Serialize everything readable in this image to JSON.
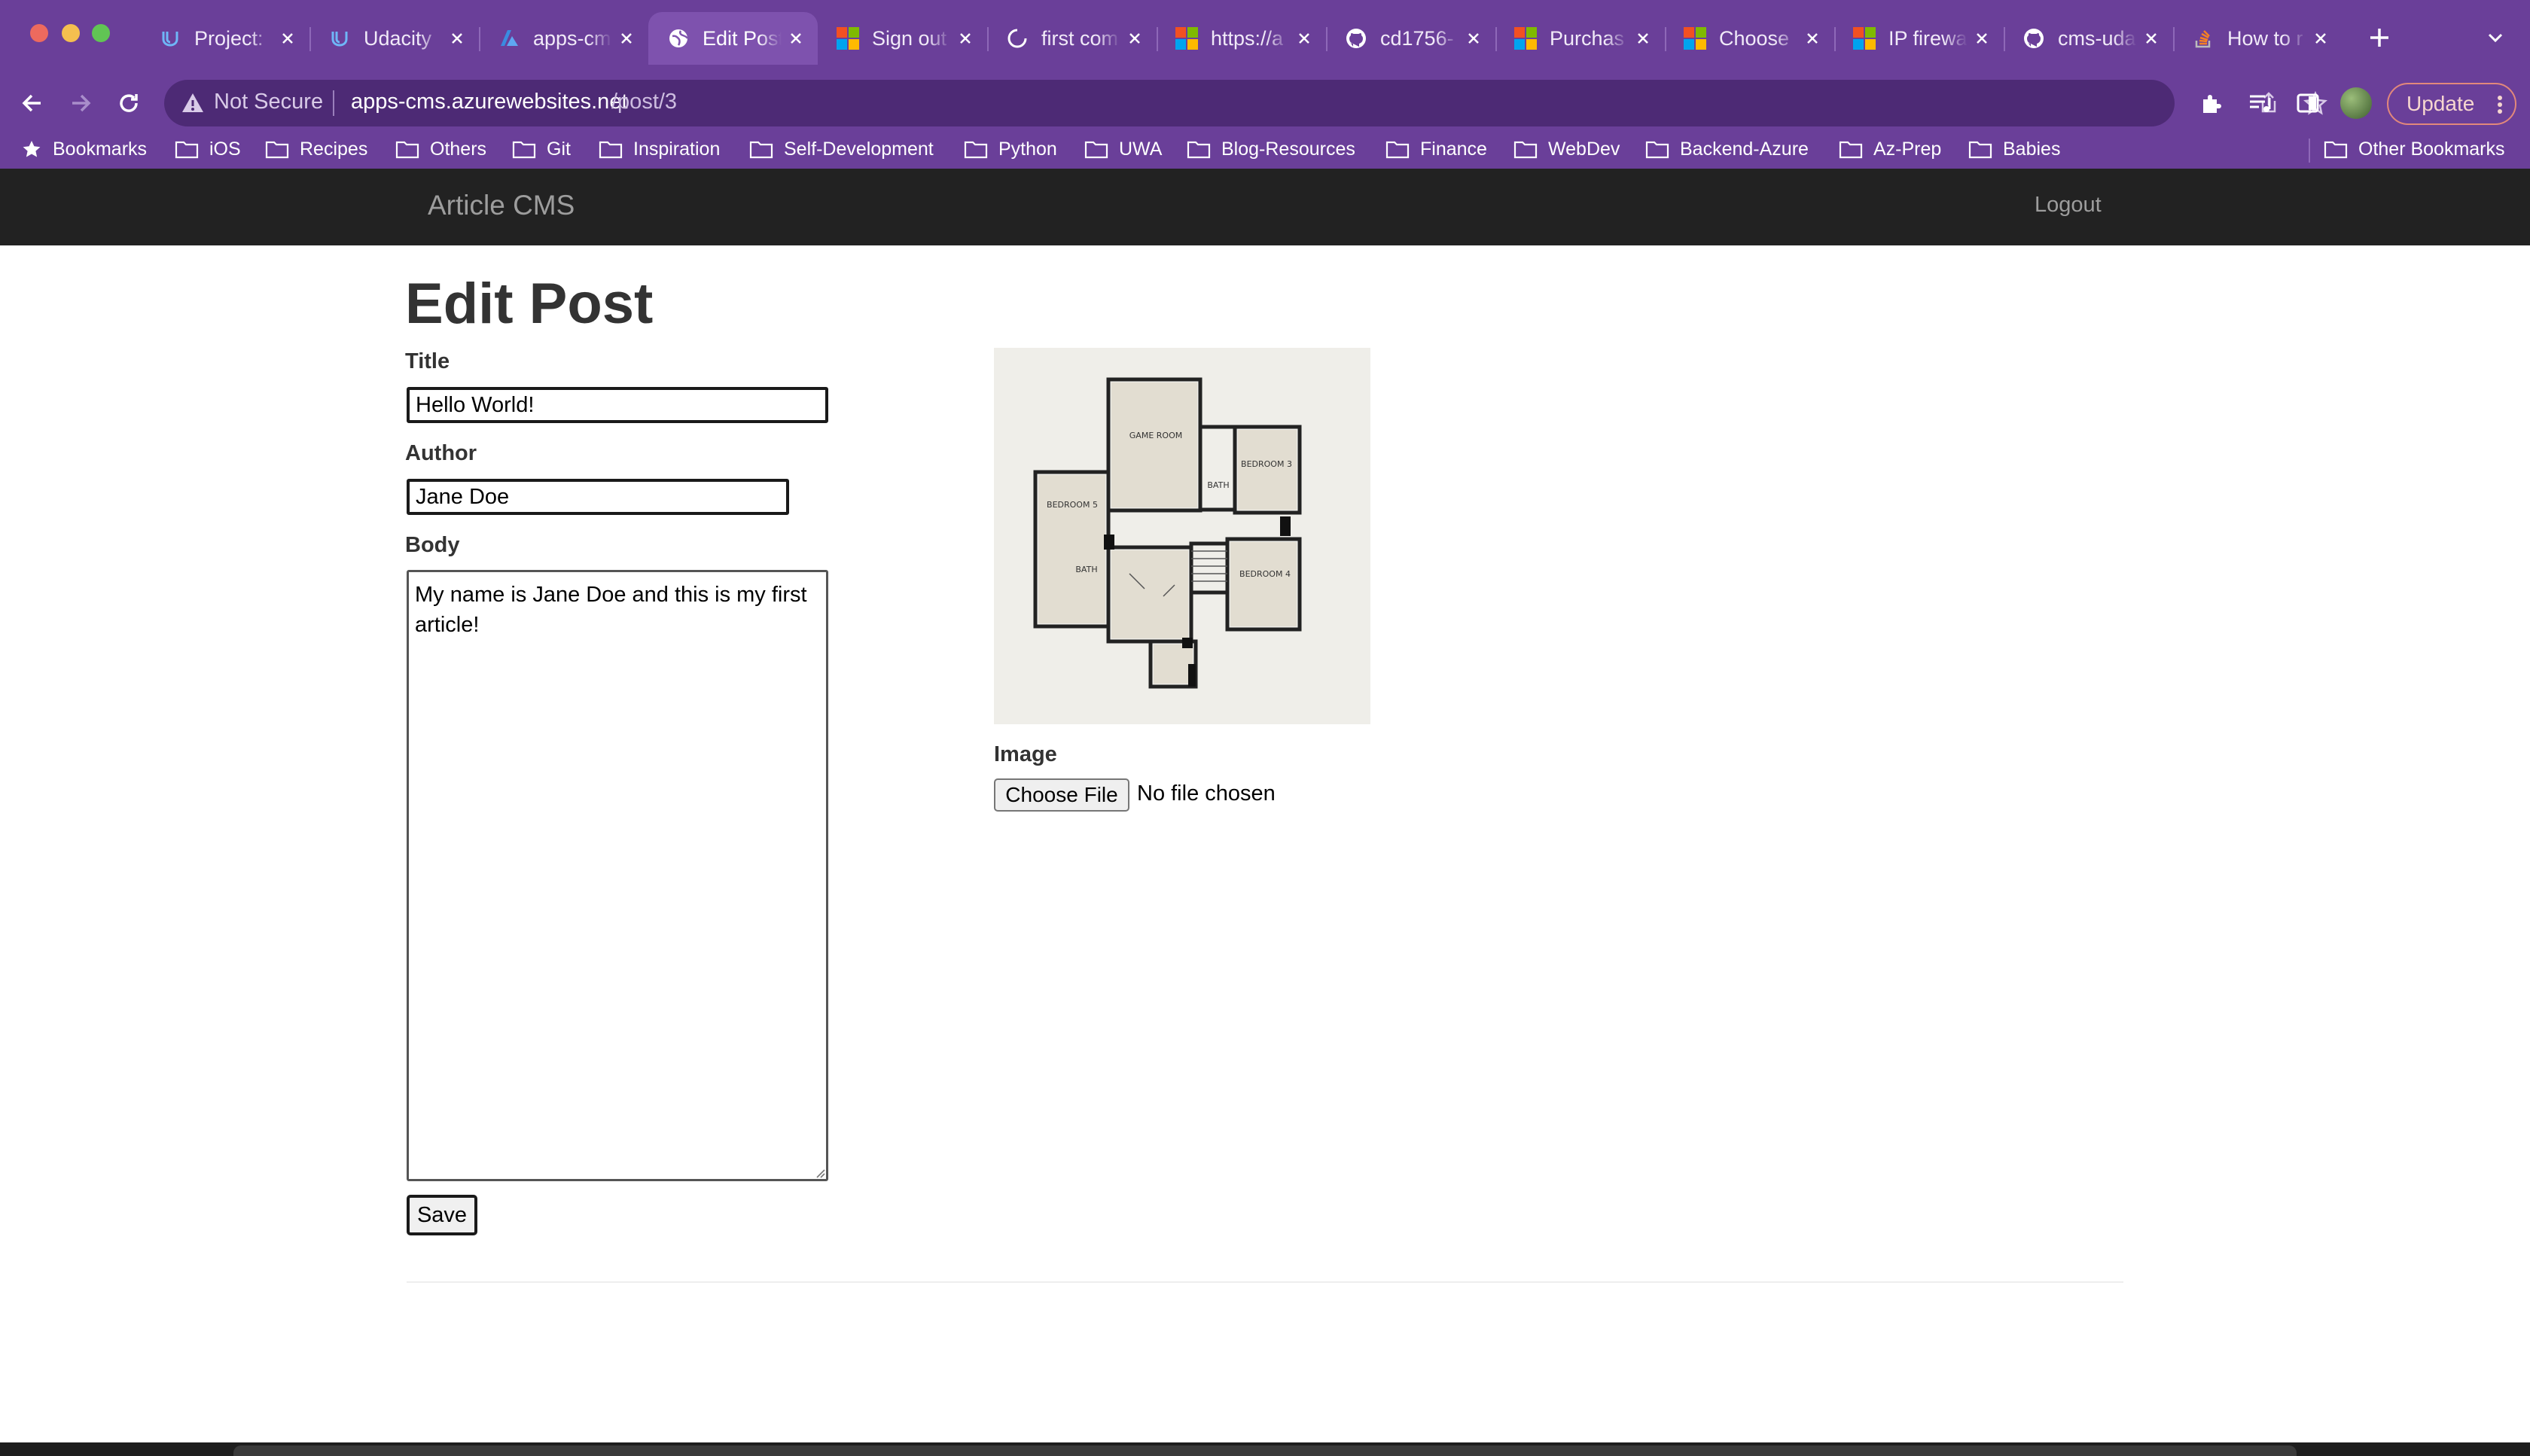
{
  "browser": {
    "tabs": [
      {
        "title": "Project:",
        "icon": "udacity-icon",
        "active": false
      },
      {
        "title": "Udacity",
        "icon": "udacity-icon",
        "active": false
      },
      {
        "title": "apps-cm",
        "icon": "azure-icon",
        "active": false
      },
      {
        "title": "Edit Post",
        "icon": "globe-icon",
        "active": true
      },
      {
        "title": "Sign out",
        "icon": "microsoft-icon",
        "active": false
      },
      {
        "title": "first com",
        "icon": "loading-icon",
        "active": false
      },
      {
        "title": "https://a",
        "icon": "microsoft-icon",
        "active": false
      },
      {
        "title": "cd1756-",
        "icon": "github-icon",
        "active": false
      },
      {
        "title": "Purchas",
        "icon": "microsoft-icon",
        "active": false
      },
      {
        "title": "Choose",
        "icon": "microsoft-icon",
        "active": false
      },
      {
        "title": "IP firewa",
        "icon": "microsoft-icon",
        "active": false
      },
      {
        "title": "cms-uda",
        "icon": "github-icon",
        "active": false
      },
      {
        "title": "How to r",
        "icon": "stackoverflow-icon",
        "active": false
      }
    ],
    "address": {
      "security_label": "Not Secure",
      "url_host": "apps-cms.azurewebsites.net",
      "url_path": "/post/3"
    },
    "update_label": "Update",
    "bookmarks": [
      "Bookmarks",
      "iOS",
      "Recipes",
      "Others",
      "Git",
      "Inspiration",
      "Self-Development",
      "Python",
      "UWA",
      "Blog-Resources",
      "Finance",
      "WebDev",
      "Backend-Azure",
      "Az-Prep",
      "Babies"
    ],
    "other_bookmarks": "Other Bookmarks",
    "colors": {
      "frame": "#6a3f99",
      "active_tab": "#7e52ae",
      "omnibox": "#4d2a75"
    }
  },
  "navbar": {
    "brand": "Article CMS",
    "logout": "Logout"
  },
  "page": {
    "heading": "Edit Post",
    "form": {
      "title_label": "Title",
      "title_value": "Hello World!",
      "author_label": "Author",
      "author_value": "Jane Doe",
      "body_label": "Body",
      "body_value": "My name is Jane Doe and this is my first article!",
      "save_label": "Save"
    },
    "image": {
      "label": "Image",
      "alt": "floor plan",
      "room_labels": [
        "GAME ROOM",
        "BEDROOM 3",
        "BEDROOM 5",
        "BEDROOM 4",
        "BATH",
        "BATH"
      ],
      "choose_file_label": "Choose File",
      "no_file_text": "No file chosen"
    }
  }
}
